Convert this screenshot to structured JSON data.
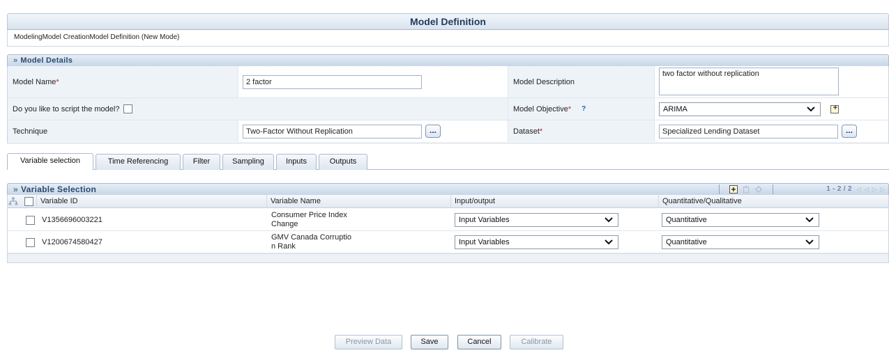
{
  "window": {
    "title": "Model Definition",
    "breadcrumb": "ModelingModel CreationModel Definition (New Mode)"
  },
  "details": {
    "section_title": "Model Details",
    "model_name_label": "Model Name",
    "model_name_value": "2 factor",
    "model_description_label": "Model Description",
    "model_description_value": "two factor without replication",
    "script_label": "Do you like to script the model?",
    "model_objective_label": "Model Objective",
    "model_objective_value": "ARIMA",
    "technique_label": "Technique",
    "technique_value": "Two-Factor Without Replication",
    "dataset_label": "Dataset",
    "dataset_value": "Specialized Lending Dataset",
    "required_marker": "*",
    "ellipsis": "...",
    "help_mark": "?"
  },
  "tabs": [
    {
      "label": "Variable selection",
      "active": true
    },
    {
      "label": "Time Referencing",
      "active": false
    },
    {
      "label": "Filter",
      "active": false
    },
    {
      "label": "Sampling",
      "active": false
    },
    {
      "label": "Inputs",
      "active": false
    },
    {
      "label": "Outputs",
      "active": false
    }
  ],
  "variable_selection": {
    "section_title": "Variable Selection",
    "pagination": "1 - 2 / 2",
    "columns": [
      "Variable ID",
      "Variable Name",
      "Input/output",
      "Quantitative/Qualitative"
    ],
    "rows": [
      {
        "id": "V1356696003221",
        "name_line1": "Consumer Price Index",
        "name_line2": "Change",
        "io": "Input Variables",
        "qq": "Quantitative"
      },
      {
        "id": "V1200674580427",
        "name_line1": "GMV Canada Corruptio",
        "name_line2": "n Rank",
        "io": "Input Variables",
        "qq": "Quantitative"
      }
    ]
  },
  "actions": {
    "preview": "Preview Data",
    "save": "Save",
    "cancel": "Cancel",
    "calibrate": "Calibrate"
  },
  "colors": {
    "header_text": "#1f3b5c",
    "required": "#d02020",
    "disabled_text": "#8a95a3"
  }
}
